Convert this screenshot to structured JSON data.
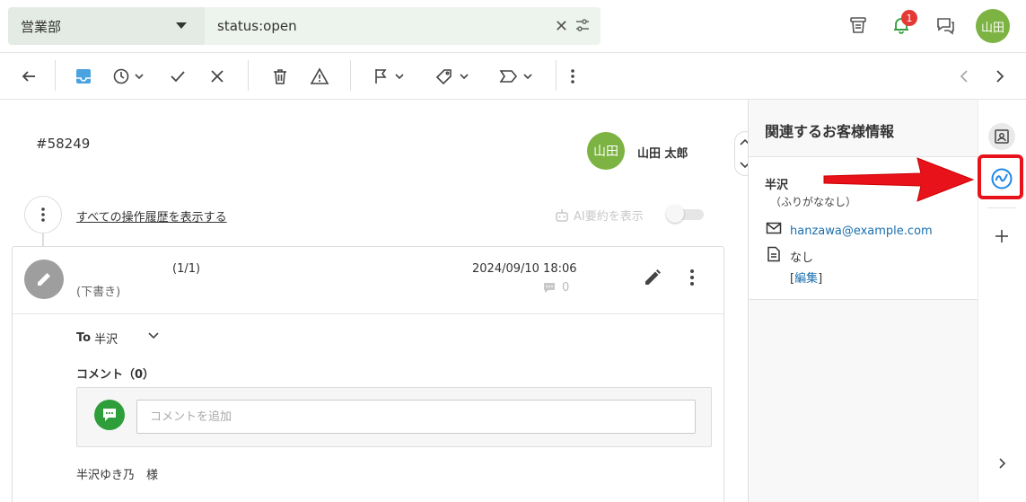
{
  "topbar": {
    "department": "営業部",
    "search_value": "status:open",
    "notification_count": "1",
    "user_initials": "山田"
  },
  "ticket": {
    "id": "#58249",
    "assignee_initials": "山田",
    "assignee_name": "山田 太郎",
    "history_link": "すべての操作履歴を表示する",
    "ai_summary_label": "AI要約を表示"
  },
  "draft": {
    "count": "(1/1)",
    "label": "(下書き)",
    "date": "2024/09/10 18:06",
    "comment_count": "0",
    "to_label": "To",
    "to_name": "半沢",
    "comment_title": "コメント（0）",
    "comment_placeholder": "コメントを追加",
    "recipient_line": "半沢ゆき乃　様"
  },
  "customer_panel": {
    "title": "関連するお客様情報",
    "name": "半沢",
    "furigana": "（ふりがななし）",
    "email": "hanzawa@example.com",
    "note": "なし",
    "edit_open": "[",
    "edit_label": "編集",
    "edit_close": "]"
  },
  "colors": {
    "accent_green": "#7cb342",
    "highlight_red": "#e8121b",
    "link_blue": "#1a6fb0"
  }
}
